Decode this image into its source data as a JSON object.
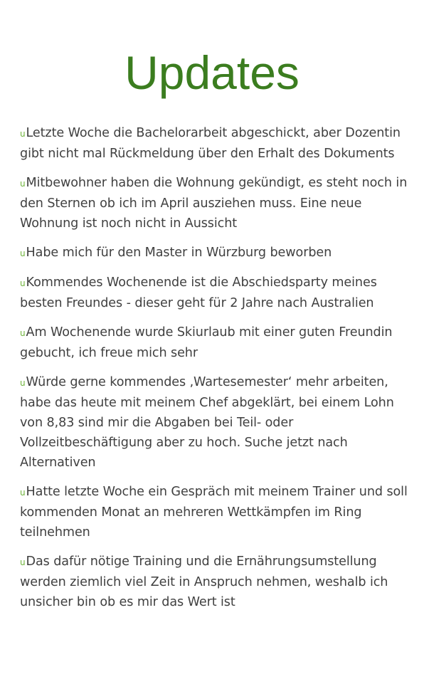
{
  "title": "Updates",
  "bullet_marker": "u",
  "colors": {
    "title": "#3b7d1f",
    "marker": "#6fb33a",
    "text": "#404040"
  },
  "bullets": [
    "Letzte Woche die Bachelorarbeit abgeschickt, aber Dozentin gibt nicht mal Rückmeldung über den Erhalt des Dokuments",
    "Mitbewohner haben die Wohnung gekündigt, es steht noch in den Sternen ob ich im April ausziehen muss. Eine neue Wohnung ist noch nicht in Aussicht",
    "Habe mich für den Master in Würzburg beworben",
    "Kommendes Wochenende ist die Abschiedsparty meines besten Freundes - dieser geht für 2 Jahre nach Australien",
    "Am Wochenende wurde Skiurlaub mit einer guten Freundin gebucht, ich freue mich sehr",
    "Würde gerne kommendes ‚Wartesemester‘ mehr arbeiten, habe das heute mit meinem Chef abgeklärt, bei einem Lohn von 8,83 sind mir die Abgaben bei Teil- oder Vollzeitbeschäftigung aber zu hoch. Suche jetzt nach Alternativen",
    "Hatte letzte Woche ein Gespräch mit meinem Trainer und soll kommenden Monat an mehreren Wettkämpfen im Ring teilnehmen",
    "Das dafür nötige Training und die Ernährungsumstellung werden ziemlich viel Zeit in Anspruch nehmen, weshalb ich unsicher bin ob es mir das Wert ist"
  ]
}
